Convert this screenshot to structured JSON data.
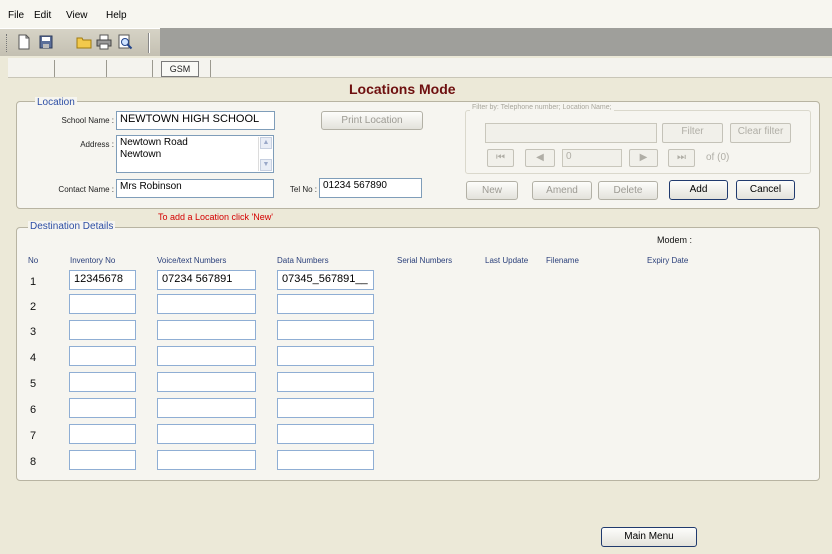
{
  "menu": {
    "file": "File",
    "edit": "Edit",
    "view": "View",
    "help": "Help"
  },
  "toolbar": {
    "new_icon": "new-document-icon",
    "save_icon": "save-icon",
    "open_icon": "open-folder-icon",
    "print_icon": "print-icon",
    "preview_icon": "print-preview-icon"
  },
  "tabs": {
    "gsm": "GSM"
  },
  "title": "Locations Mode",
  "location": {
    "legend": "Location",
    "school_label": "School Name :",
    "school_value": "NEWTOWN HIGH SCHOOL",
    "address_label": "Address :",
    "address_value": "Newtown Road\nNewtown",
    "contact_label": "Contact Name :",
    "contact_value": "Mrs Robinson",
    "tel_label": "Tel No :",
    "tel_value": "01234 567890",
    "print_button": "Print Location"
  },
  "filter": {
    "legend": "Filter by: Telephone number; Location Name;",
    "filter_button": "Filter",
    "clear_button": "Clear filter",
    "record_value": "0",
    "of_text": "of  (0)"
  },
  "actions": {
    "new": "New",
    "amend": "Amend",
    "delete": "Delete",
    "add": "Add",
    "cancel": "Cancel"
  },
  "hint": "To add a Location click 'New'",
  "destination": {
    "legend": "Destination Details",
    "modem_label": "Modem :",
    "headers": {
      "no": "No",
      "inventory": "Inventory No",
      "voice": "Voice/text Numbers",
      "data": "Data Numbers",
      "serial": "Serial Numbers",
      "last_update": "Last Update",
      "filename": "Filename",
      "expiry": "Expiry Date"
    },
    "rows": [
      {
        "no": "1",
        "inventory": "12345678",
        "voice": "07234 567891",
        "data": "07345_567891__"
      },
      {
        "no": "2",
        "inventory": "",
        "voice": "",
        "data": ""
      },
      {
        "no": "3",
        "inventory": "",
        "voice": "",
        "data": ""
      },
      {
        "no": "4",
        "inventory": "",
        "voice": "",
        "data": ""
      },
      {
        "no": "5",
        "inventory": "",
        "voice": "",
        "data": ""
      },
      {
        "no": "6",
        "inventory": "",
        "voice": "",
        "data": ""
      },
      {
        "no": "7",
        "inventory": "",
        "voice": "",
        "data": ""
      },
      {
        "no": "8",
        "inventory": "",
        "voice": "",
        "data": ""
      }
    ]
  },
  "main_menu_button": "Main Menu"
}
